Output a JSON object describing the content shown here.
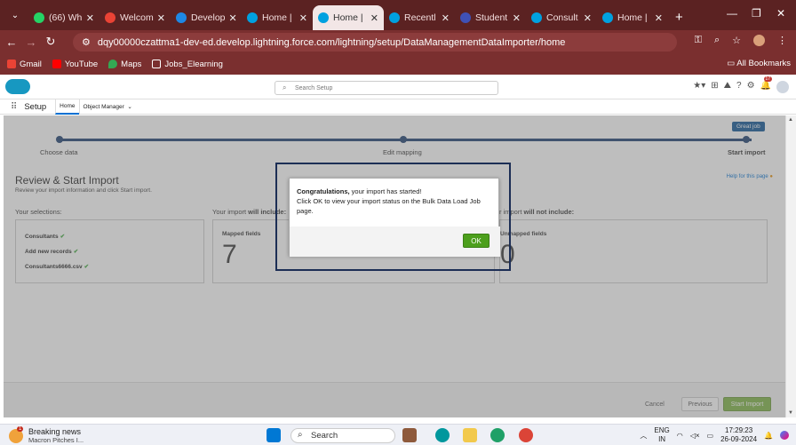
{
  "browser": {
    "tabs": [
      {
        "label": "(66) Wh",
        "color": "#25d366",
        "active": false
      },
      {
        "label": "Welcom",
        "color": "#ea4335",
        "active": false
      },
      {
        "label": "Develop",
        "color": "#1e88e5",
        "active": false
      },
      {
        "label": "Home |",
        "color": "#00a1e0",
        "active": false
      },
      {
        "label": "Home |",
        "color": "#00a1e0",
        "active": true
      },
      {
        "label": "Recentl",
        "color": "#00a1e0",
        "active": false
      },
      {
        "label": "Student",
        "color": "#3f51b5",
        "active": false
      },
      {
        "label": "Consult",
        "color": "#00a1e0",
        "active": false
      },
      {
        "label": "Home |",
        "color": "#00a1e0",
        "active": false
      }
    ],
    "url": "dqy00000czattma1-dev-ed.develop.lightning.force.com/lightning/setup/DataManagementDataImporter/home",
    "bookmarks": [
      "Gmail",
      "YouTube",
      "Maps",
      "Jobs_Elearning"
    ],
    "all_bookmarks": "All Bookmarks"
  },
  "sf": {
    "search_placeholder": "Search Setup",
    "setup_title": "Setup",
    "tabs": [
      "Home",
      "Object Manager"
    ],
    "notification_count": "17"
  },
  "wizard": {
    "steps": [
      "Choose data",
      "Edit mapping",
      "Start import"
    ],
    "badge": "Great job",
    "title": "Review & Start Import",
    "subtitle": "Review your import information and click Start import.",
    "help": "Help for this page",
    "your_selections": "Your selections:",
    "will_include_prefix": "Your import ",
    "will_include_bold": "will include:",
    "will_not_include_prefix": "r import ",
    "will_not_include_bold": "will not include:",
    "selections": [
      "Consultants",
      "Add new records",
      "Consultants6666.csv"
    ],
    "mapped_label": "Mapped fields",
    "mapped_count": "7",
    "unmapped_label": "Unmapped fields",
    "unmapped_count": "0",
    "footer": {
      "cancel": "Cancel",
      "previous": "Previous",
      "start": "Start Import"
    }
  },
  "modal": {
    "bold": "Congratulations,",
    "line1": " your import has started!",
    "line2": "Click OK to view your import status on the Bulk Data Load Job page.",
    "ok": "OK"
  },
  "taskbar": {
    "news_title": "Breaking news",
    "news_sub": "Macron Pitches I...",
    "news_badge": "1",
    "search": "Search",
    "lang": "ENG",
    "region": "IN",
    "time": "17:29:23",
    "date": "26-09-2024"
  }
}
